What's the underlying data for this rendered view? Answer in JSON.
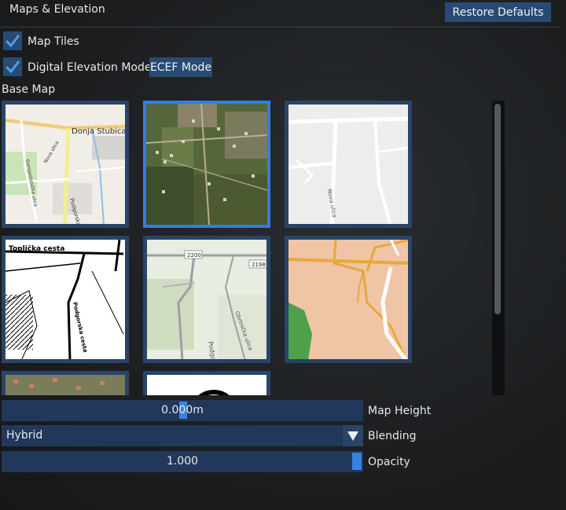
{
  "panel": {
    "title": "Maps & Elevation",
    "restore_label": "Restore Defaults"
  },
  "options": {
    "map_tiles_label": "Map Tiles",
    "map_tiles_checked": true,
    "dem_label": "Digital Elevation Model",
    "dem_checked": true,
    "ecef_label": "ECEF Mode"
  },
  "base_map": {
    "label": "Base Map",
    "selected_index": 1,
    "tiles": [
      {
        "name": "street-map",
        "labels": [
          "Donja Stubica",
          "Podgorska cesta",
          "Nova ulica",
          "Gornjostubička ulica"
        ]
      },
      {
        "name": "satellite",
        "labels": []
      },
      {
        "name": "minimal-white",
        "labels": [
          "Nova ulica"
        ]
      },
      {
        "name": "black-white",
        "labels": [
          "Toplička cesta",
          "Podgorska cesta"
        ]
      },
      {
        "name": "topographic",
        "labels": [
          "2200",
          "2198",
          "Podgor",
          "Obrtnička ulica"
        ]
      },
      {
        "name": "terrain-color",
        "labels": []
      },
      {
        "name": "satellite-2",
        "labels": []
      },
      {
        "name": "black-white-2",
        "labels": []
      }
    ]
  },
  "map_height": {
    "label": "Map Height",
    "value_text": "0.000m",
    "value": 0.0
  },
  "blending": {
    "label": "Blending",
    "selected": "Hybrid"
  },
  "opacity": {
    "label": "Opacity",
    "value_text": "1.000",
    "value": 1.0
  },
  "colors": {
    "accent": "#284b73",
    "highlight": "#2f7fe0",
    "handle": "#3a82e0"
  }
}
